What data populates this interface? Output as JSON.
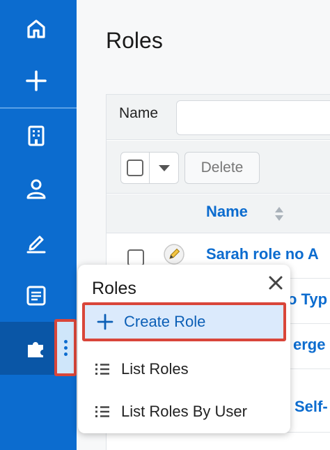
{
  "sidebar": {
    "items": [
      {
        "name": "home",
        "icon": "home-icon"
      },
      {
        "name": "quick-create",
        "icon": "plus-icon"
      },
      {
        "name": "accounts",
        "icon": "building-icon"
      },
      {
        "name": "contacts",
        "icon": "user-icon"
      },
      {
        "name": "sign",
        "icon": "signature-icon"
      },
      {
        "name": "documents",
        "icon": "document-icon"
      },
      {
        "name": "roles",
        "icon": "puzzle-icon"
      }
    ]
  },
  "page": {
    "title": "Roles"
  },
  "filter": {
    "label": "Name",
    "value": ""
  },
  "actions": {
    "delete_label": "Delete"
  },
  "table": {
    "columns": [
      {
        "label": "Name",
        "sortable": true
      }
    ],
    "rows": [
      {
        "name": "Sarah role no A"
      },
      {
        "name": "o Typ"
      },
      {
        "name": "erge"
      },
      {
        "name": "Self-"
      }
    ]
  },
  "popup": {
    "title": "Roles",
    "items": [
      {
        "label": "Create Role",
        "icon": "plus-icon",
        "highlighted": true
      },
      {
        "label": "List Roles",
        "icon": "list-icon",
        "highlighted": false
      },
      {
        "label": "List Roles By User",
        "icon": "list-icon",
        "highlighted": false
      }
    ]
  },
  "colors": {
    "sidebar": "#0c6ccf",
    "sidebar_active": "#0a56a6",
    "link": "#0c6ccf",
    "highlight_border": "#d9463a",
    "highlight_bg": "#dbeafc"
  }
}
